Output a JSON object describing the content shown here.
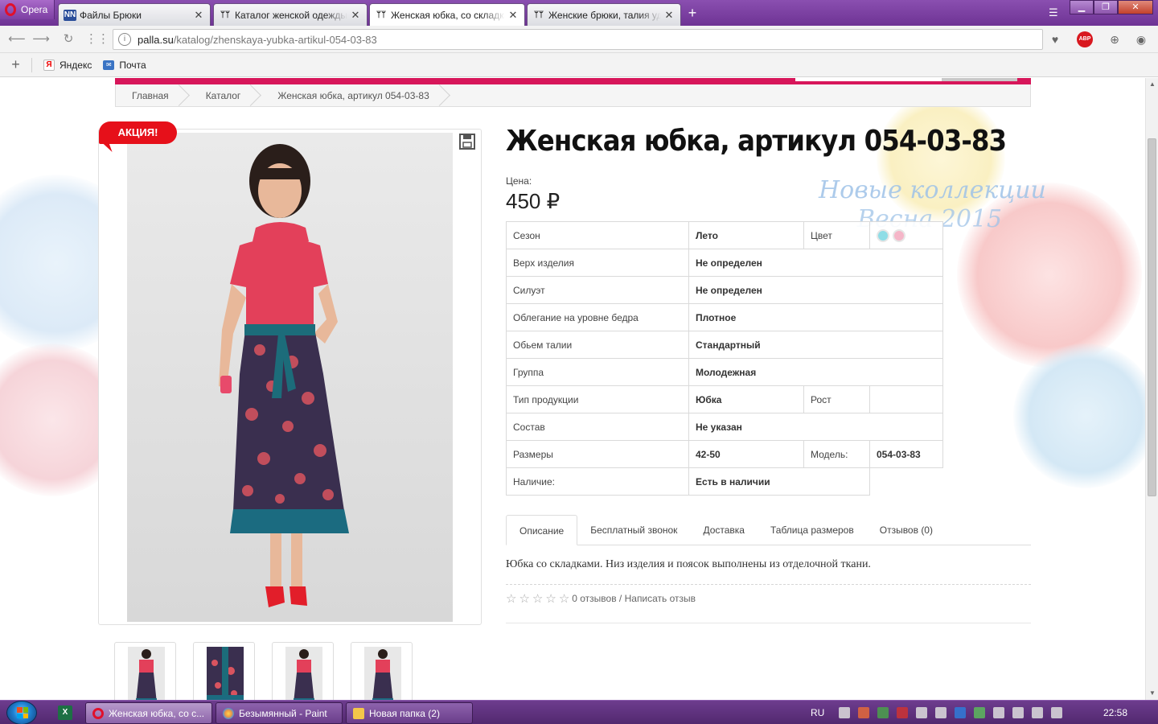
{
  "browser": {
    "opera_label": "Opera",
    "tabs": [
      {
        "title": "Файлы Брюки",
        "favicon": "NN",
        "active": false
      },
      {
        "title": "Каталог женской одежды",
        "active": false
      },
      {
        "title": "Женская юбка, со складками",
        "active": true
      },
      {
        "title": "Женские брюки, талия уд",
        "active": false
      }
    ],
    "address": {
      "host": "palla.su",
      "path": "/katalog/zhenskaya-yubka-artikul-054-03-83"
    },
    "bookmarks": [
      {
        "label": "Яндекс",
        "icon": "yandex-icon"
      },
      {
        "label": "Почта",
        "icon": "mail-icon"
      }
    ],
    "abp_label": "ABP"
  },
  "page": {
    "breadcrumb": [
      "Главная",
      "Каталог",
      "Женская юбка, артикул 054-03-83"
    ],
    "promo_badge": "АКЦИЯ!",
    "product_title": "Женская юбка, артикул 054-03-83",
    "price_label": "Цена:",
    "price": "450 ₽",
    "collection_banner": [
      "Новые коллекции",
      "Весна 2015"
    ],
    "specs": [
      {
        "label": "Сезон",
        "value": "Лето",
        "label2": "Цвет",
        "colors": [
          "#8fdde6",
          "#f5b6c8"
        ]
      },
      {
        "label": "Верх изделия",
        "value": "Не определен"
      },
      {
        "label": "Силуэт",
        "value": "Не определен"
      },
      {
        "label": "Облегание на уровне бедра",
        "value": "Плотное"
      },
      {
        "label": "Обьем талии",
        "value": "Стандартный"
      },
      {
        "label": "Группа",
        "value": "Молодежная"
      },
      {
        "label": "Тип продукции",
        "value": "Юбка",
        "label2": "Рост",
        "value2": ""
      },
      {
        "label": "Состав",
        "value": "Не указан"
      },
      {
        "label": "Размеры",
        "value": "42-50",
        "label2": "Модель:",
        "value2": "054-03-83"
      },
      {
        "label": "Наличие:",
        "value": "Есть в наличии"
      }
    ],
    "tabs": [
      "Описание",
      "Бесплатный звонок",
      "Доставка",
      "Таблица размеров",
      "Отзывов (0)"
    ],
    "description": "Юбка со складками. Низ изделия и поясок выполнены из отделочной ткани.",
    "rating": {
      "stars": 0,
      "max": 5,
      "text": "0 отзывов / Написать отзыв"
    },
    "thumbnail_count": 4
  },
  "taskbar": {
    "tasks": [
      {
        "label": "Женская юбка, со с...",
        "icon": "opera-icon",
        "active": true
      },
      {
        "label": "Безымянный - Paint",
        "icon": "paint-icon",
        "active": false
      },
      {
        "label": "Новая папка (2)",
        "icon": "folder-icon",
        "active": false
      }
    ],
    "language": "RU",
    "clock": "22:58"
  }
}
